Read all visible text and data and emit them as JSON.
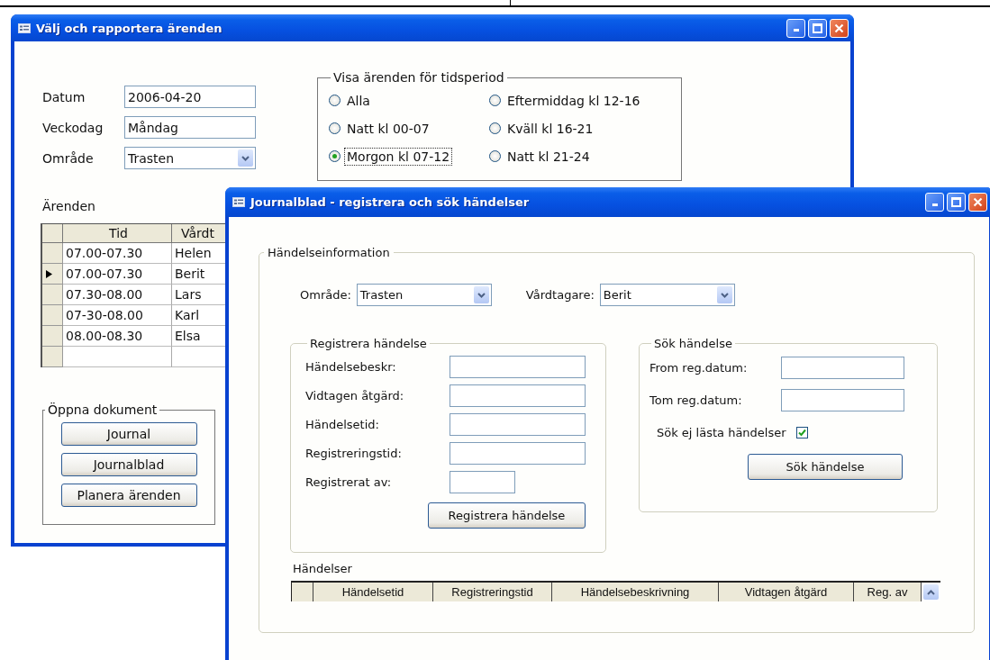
{
  "main_window": {
    "title": "Välj och rapportera ärenden",
    "fields": [
      {
        "label": "Datum",
        "value": "2006-04-20",
        "kind": "text"
      },
      {
        "label": "Veckodag",
        "value": "Måndag",
        "kind": "text"
      },
      {
        "label": "Område",
        "value": "Trasten",
        "kind": "dropdown"
      }
    ],
    "period_group": {
      "title": "Visa ärenden för tidsperiod",
      "options": [
        {
          "label": "Alla",
          "selected": false
        },
        {
          "label": "Eftermiddag kl 12-16",
          "selected": false
        },
        {
          "label": "Natt kl 00-07",
          "selected": false
        },
        {
          "label": "Kväll kl 16-21",
          "selected": false
        },
        {
          "label": "Morgon kl 07-12",
          "selected": true
        },
        {
          "label": "Natt kl 21-24",
          "selected": false
        }
      ]
    },
    "cases": {
      "label": "Ärenden",
      "columns": [
        "Tid",
        "Vårdt"
      ],
      "rows": [
        {
          "cells": [
            "07.00-07.30",
            "Helen"
          ],
          "selected": false
        },
        {
          "cells": [
            "07.00-07.30",
            "Berit"
          ],
          "selected": true
        },
        {
          "cells": [
            "07.30-08.00",
            "Lars"
          ],
          "selected": false
        },
        {
          "cells": [
            "07-30-08.00",
            "Karl"
          ],
          "selected": false
        },
        {
          "cells": [
            "08.00-08.30",
            "Elsa"
          ],
          "selected": false
        }
      ]
    },
    "documents_group": {
      "title": "Öppna dokument",
      "buttons": [
        "Journal",
        "Journalblad",
        "Planera ärenden"
      ]
    }
  },
  "journal_window": {
    "title": "Journalblad - registrera och sök händelser",
    "info_group": {
      "title": "Händelseinformation",
      "dropdowns": [
        {
          "label": "Område:",
          "value": "Trasten"
        },
        {
          "label": "Vårdtagare:",
          "value": "Berit"
        }
      ]
    },
    "register_group": {
      "title": "Registrera händelse",
      "fields": [
        {
          "label": "Händelsebeskr:",
          "kind": "long"
        },
        {
          "label": "Vidtagen åtgärd:",
          "kind": "long"
        },
        {
          "label": "Händelsetid:",
          "kind": "long"
        },
        {
          "label": "Registreringstid:",
          "kind": "long"
        },
        {
          "label": "Registrerat av:",
          "kind": "short"
        }
      ],
      "button": "Registrera händelse"
    },
    "search_group": {
      "title": "Sök händelse",
      "fields": [
        {
          "label": "From reg.datum:"
        },
        {
          "label": "Tom reg.datum:"
        }
      ],
      "checkbox": {
        "label": "Sök ej lästa händelser",
        "checked": true
      },
      "button": "Sök händelse"
    },
    "events": {
      "label": "Händelser",
      "columns": [
        "Händelsetid",
        "Registreringstid",
        "Händelsebeskrivning",
        "Vidtagen åtgärd",
        "Reg. av"
      ]
    }
  }
}
